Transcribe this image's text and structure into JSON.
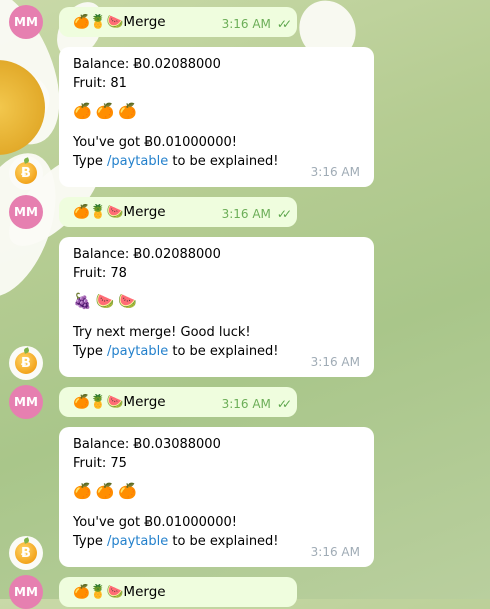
{
  "messages": [
    {
      "out": {
        "avatar": "MM",
        "text": "🍊🍍🍉Merge",
        "time": "3:16 AM",
        "status": "✓✓"
      },
      "in": {
        "balance": "Balance: Ƀ0.02088000",
        "fruit": "Fruit: 81",
        "reels": "🍊🍊🍊",
        "result": "You've got Ƀ0.01000000!",
        "type_prefix": "Type ",
        "command": "/paytable",
        "type_suffix": " to be explained!",
        "time": "3:16 AM",
        "bot_icon": "Ƀ"
      }
    },
    {
      "out": {
        "avatar": "MM",
        "text": "🍊🍍🍉Merge",
        "time": "3:16 AM",
        "status": "✓✓"
      },
      "in": {
        "balance": "Balance: Ƀ0.02088000",
        "fruit": "Fruit: 78",
        "reels": "🍇🍉🍉",
        "result": "Try next merge! Good luck!",
        "type_prefix": "Type ",
        "command": "/paytable",
        "type_suffix": " to be explained!",
        "time": "3:16 AM",
        "bot_icon": "Ƀ"
      }
    },
    {
      "out": {
        "avatar": "MM",
        "text": "🍊🍍🍉Merge",
        "time": "3:16 AM",
        "status": "✓✓"
      },
      "in": {
        "balance": "Balance: Ƀ0.03088000",
        "fruit": "Fruit: 75",
        "reels": "🍊🍊🍊",
        "result": "You've got Ƀ0.01000000!",
        "type_prefix": "Type ",
        "command": "/paytable",
        "type_suffix": " to be explained!",
        "time": "3:16 AM",
        "bot_icon": "Ƀ"
      }
    },
    {
      "out": {
        "avatar": "MM",
        "text": "🍊🍍🍉Merge"
      }
    }
  ]
}
